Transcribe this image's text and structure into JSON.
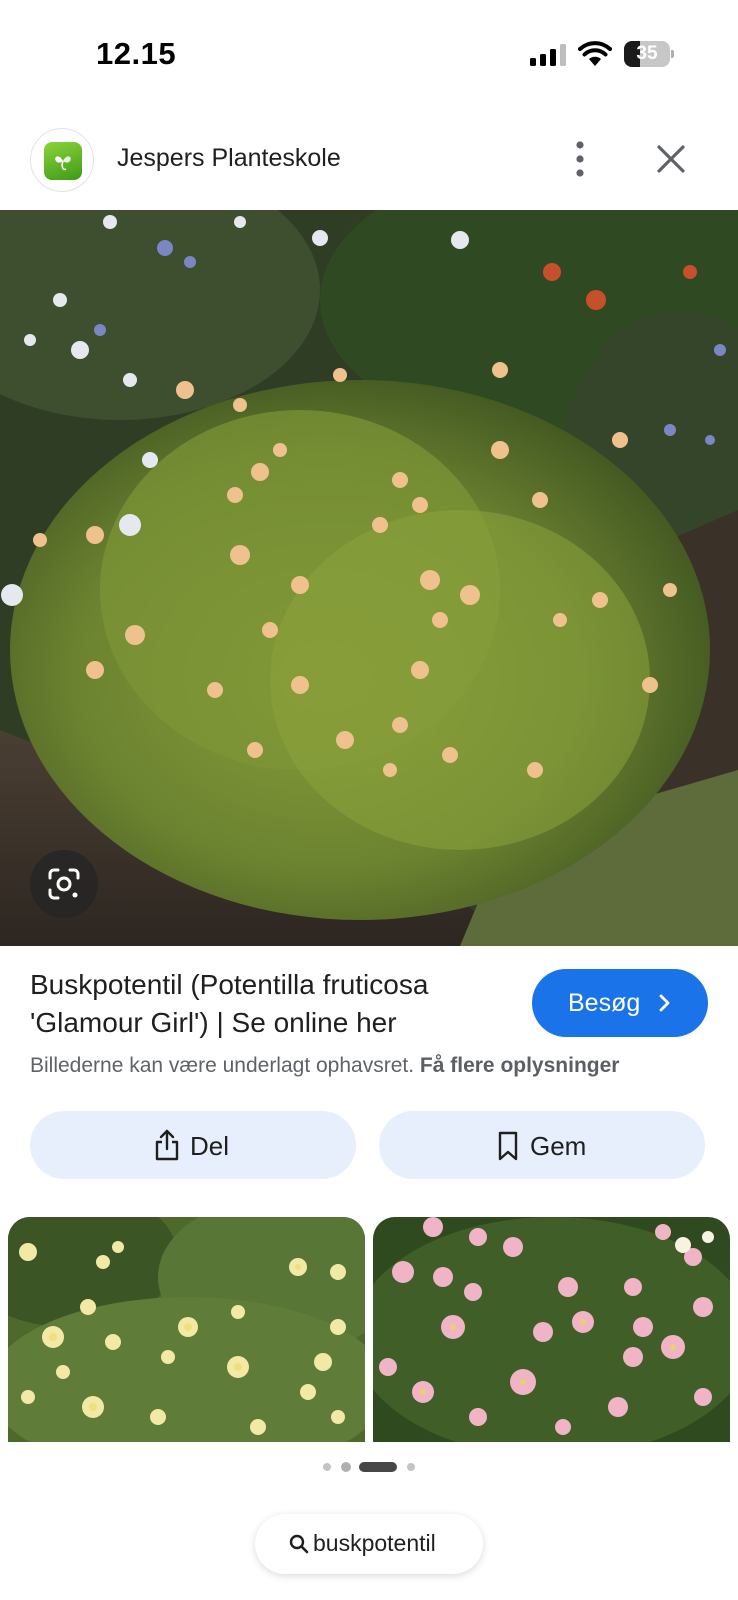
{
  "status_bar": {
    "time": "12.15",
    "battery_level": "35"
  },
  "site": {
    "name": "Jespers Planteskole",
    "logo_icon": "leaf-logo-icon"
  },
  "header_actions": {
    "more_icon": "more-vertical-icon",
    "close_icon": "close-icon"
  },
  "image": {
    "lens_icon": "google-lens-icon"
  },
  "result": {
    "title": "Buskpotentil (Potentilla fruticosa 'Glamour Girl') | Se online her",
    "visit_label": "Besøg",
    "copyright_text": "Billederne kan være underlagt ophavsret.",
    "more_info_link": "Få flere oplysninger"
  },
  "actions": {
    "share_label": "Del",
    "save_label": "Gem"
  },
  "pager": {
    "page_count": 4,
    "active_index": 2
  },
  "search_chip": {
    "query": "buskpotentil"
  },
  "colors": {
    "accent": "#1a73e8",
    "action_button_bg": "#e8effc",
    "secondary_text": "#5f6368"
  }
}
